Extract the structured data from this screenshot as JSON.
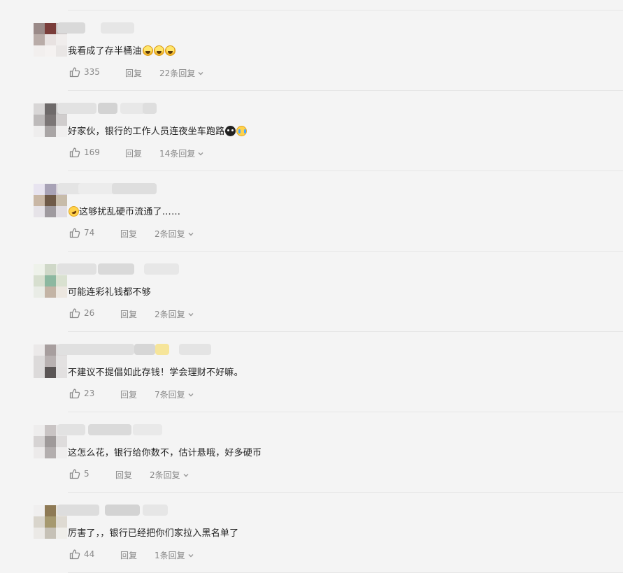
{
  "comments": [
    {
      "text": "我看成了存半桶油",
      "emojis": [
        "grinning-sweat-emoji",
        "grinning-sweat-emoji",
        "grinning-sweat-emoji"
      ],
      "likes": "335",
      "reply_label": "回复",
      "replies_label": "22条回复",
      "avatar_colors": [
        "#9a8a88",
        "#7a3d3a",
        "#c7c0bf",
        "#b9aca8",
        "#e8e2e1",
        "#f0edec",
        "#f2efee",
        "#f5f2f1",
        "#e9e6e5"
      ],
      "name_blur_colors": [
        "#d9d9d9",
        "#e6e6e6",
        "#dcdcdc",
        "#e9e9e9"
      ]
    },
    {
      "text": "好家伙，银行的工作人员连夜坐车跑路",
      "emojis": [
        "dark-emoji",
        "cry-emoji"
      ],
      "likes": "169",
      "reply_label": "回复",
      "replies_label": "14条回复",
      "avatar_colors": [
        "#d8d6d6",
        "#6e6a6a",
        "#c9c7c7",
        "#bdbaba",
        "#7b7676",
        "#d0cdcd",
        "#eeeded",
        "#a9a5a5",
        "#f0efef"
      ],
      "name_blur_colors": [
        "#e2e2e2",
        "#d3d3d3",
        "#e8e8e8",
        "#dedede"
      ]
    },
    {
      "text": "这够扰乱硬币流通了……",
      "emojis": [
        "rofl-emoji"
      ],
      "likes": "74",
      "reply_label": "回复",
      "replies_label": "2条回复",
      "avatar_colors": [
        "#e8e4f0",
        "#a8a2b6",
        "#d6cfd9",
        "#c9b7a5",
        "#6f5a48",
        "#c7bba9",
        "#e6e3e8",
        "#9f9a9f",
        "#e1dde2"
      ],
      "name_blur_colors": [
        "#e4e4e4",
        "#ececec",
        "#dedede",
        "#eaeaea"
      ]
    },
    {
      "text": "可能连彩礼钱都不够",
      "emojis": [],
      "likes": "26",
      "reply_label": "回复",
      "replies_label": "2条回复",
      "avatar_colors": [
        "#eef2ea",
        "#cfd8c8",
        "#e8ede4",
        "#d7dfcf",
        "#8cb8a0",
        "#d9e1d0",
        "#e9ece6",
        "#c3b4a5",
        "#ece7e0"
      ],
      "name_blur_colors": [
        "#e1e1e1",
        "#d9d9d9",
        "#e7e7e7",
        "#ebebeb"
      ]
    },
    {
      "text": "不建议不提倡如此存钱！学会理财不好嘛。",
      "emojis": [],
      "likes": "23",
      "reply_label": "回复",
      "replies_label": "7条回复",
      "avatar_colors": [
        "#ebe9e9",
        "#a79e9e",
        "#dedbdb",
        "#dcdada",
        "#b8b1b1",
        "#e3e1e1",
        "#dcdada",
        "#5a5555",
        "#e2e0e0"
      ],
      "name_blur_colors": [
        "#e0e0e0",
        "#d6d6d6",
        "#f6e59a",
        "#e4e4e4"
      ]
    },
    {
      "text": "这怎么花，银行给你数不，估计悬哦，好多硬币",
      "emojis": [],
      "likes": "5",
      "reply_label": "回复",
      "replies_label": "2条回复",
      "avatar_colors": [
        "#eeeded",
        "#c9c4c4",
        "#e9e7e7",
        "#d6d3d3",
        "#9f9a9a",
        "#dedcdc",
        "#eceaea",
        "#b3aeae",
        "#efeeee"
      ],
      "name_blur_colors": [
        "#e2e2e2",
        "#dadada",
        "#e9e9e9",
        "#e5e5e5"
      ]
    },
    {
      "text": "厉害了，，银行已经把你们家拉入黑名单了",
      "emojis": [],
      "likes": "44",
      "reply_label": "回复",
      "replies_label": "1条回复",
      "avatar_colors": [
        "#f0efef",
        "#8e7a55",
        "#e8e4dd",
        "#d9d5cc",
        "#a6996f",
        "#dedad2",
        "#ebe9e6",
        "#c6c1b6",
        "#efeeea"
      ],
      "name_blur_colors": [
        "#dddddd",
        "#d3d3d3",
        "#e6e6e6",
        "#e1e1e1"
      ]
    }
  ]
}
